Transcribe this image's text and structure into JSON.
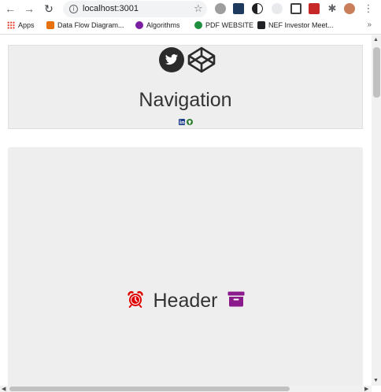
{
  "browser": {
    "url": "localhost:3001",
    "bookmarks": [
      {
        "label": "Apps",
        "color": "#ea4335"
      },
      {
        "label": "Data Flow Diagram...",
        "color": "#e8710a"
      },
      {
        "label": "Algorithms",
        "color": "#7b1fa2"
      },
      {
        "label": "PDF WEBSITE",
        "color": "#1e8e3e"
      },
      {
        "label": "NEF Investor Meet...",
        "color": "#202124"
      }
    ],
    "more_glyph": "»"
  },
  "navigation": {
    "title": "Navigation",
    "icons": [
      "twitter-icon",
      "codepen-icon",
      "linkedin-icon",
      "github-icon"
    ]
  },
  "header": {
    "title": "Header",
    "icons": [
      "alarm-clock-icon",
      "archive-icon"
    ],
    "colors": {
      "alarm": "#e00000",
      "archive": "#8b1a8b"
    }
  }
}
